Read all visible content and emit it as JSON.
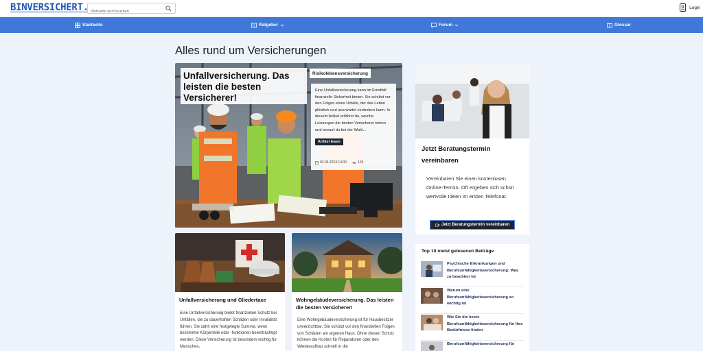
{
  "header": {
    "logo": "BINVERSICHERT.DE",
    "search_placeholder": "Webseite durchsuchen",
    "login_label": "Login"
  },
  "nav": {
    "items": [
      {
        "label": "Startseite",
        "icon": "grid-icon"
      },
      {
        "label": "Ratgeber",
        "icon": "book-icon",
        "dropdown": true
      },
      {
        "label": "Forum",
        "icon": "chat-icon",
        "dropdown": true
      },
      {
        "label": "Glossar",
        "icon": "open-book-icon"
      }
    ]
  },
  "main": {
    "title": "Alles rund um Versicherungen",
    "hero": {
      "title": "Unfallversicherung. Das leisten die besten Versicherer!",
      "tag": "Risikolebensversicherung",
      "excerpt": "Eine Unfallversicherung kann im Ernstfall finanzielle Sicherheit bieten. Sie schützt vor den Folgen eines Unfalls, der das Leben plötzlich und unerwartet verändern kann. In diesem Artikel erfährst du, welche Leistungen die besten Versicherer bieten und worauf du bei der Wahl...",
      "button": "Artikel lesen",
      "date": "03.06.2024 14:00",
      "views": "104"
    },
    "cards": [
      {
        "title": "Unfallversicherung und Gliedertaxe",
        "excerpt": "Eine Unfallversicherung bietet finanziellen Schutz bei Unfällen, die zu dauerhaften Schäden oder Invalidität führen. Sie zahlt eine festgelegte Summe, wenn bestimmte Körperteile oder -funktionen beeinträchtigt werden. Diese Versicherung ist besonders wichtig für Menschen,"
      },
      {
        "title": "Wohngebäudeversicherung. Das leisten die besten Versicherer!",
        "excerpt": "Eine Wohngebäudeversicherung ist für Hausbesitzer unverzichtbar. Sie schützt vor den finanziellen Folgen von Schäden am eigenen Haus. Ohne diesen Schutz können die Kosten für Reparaturen oder den Wiederaufbau schnell in die"
      }
    ]
  },
  "sidebar": {
    "consult": {
      "title": "Jetzt Beratungstermin vereinbaren",
      "text": "Vereinbaren Sie einen kostenlosen Online-Termin. Oft ergeben sich schon wertvolle Ideen im ersten Telefonat.",
      "button": "Jetzt Beratungstermin vereinbaren"
    },
    "top_list": {
      "title": "Top 10 meist gelesenen Beiträge",
      "items": [
        "Psychische Erkrankungen und Berufsunfähigkeitsversicherung: Was zu beachten ist",
        "Warum eine Berufsunfähigkeitsversicherung so wichtig ist",
        "Wie Sie die beste Berufsunfähigkeitsversicherung für Ihre Bedürfnisse finden",
        "Berufsunfähigkeitsversicherung für"
      ]
    }
  },
  "colors": {
    "nav_bg": "#3f78d6",
    "logo": "#2456b5",
    "button_dark": "#1d2433",
    "page_bg": "#eef3fb"
  }
}
